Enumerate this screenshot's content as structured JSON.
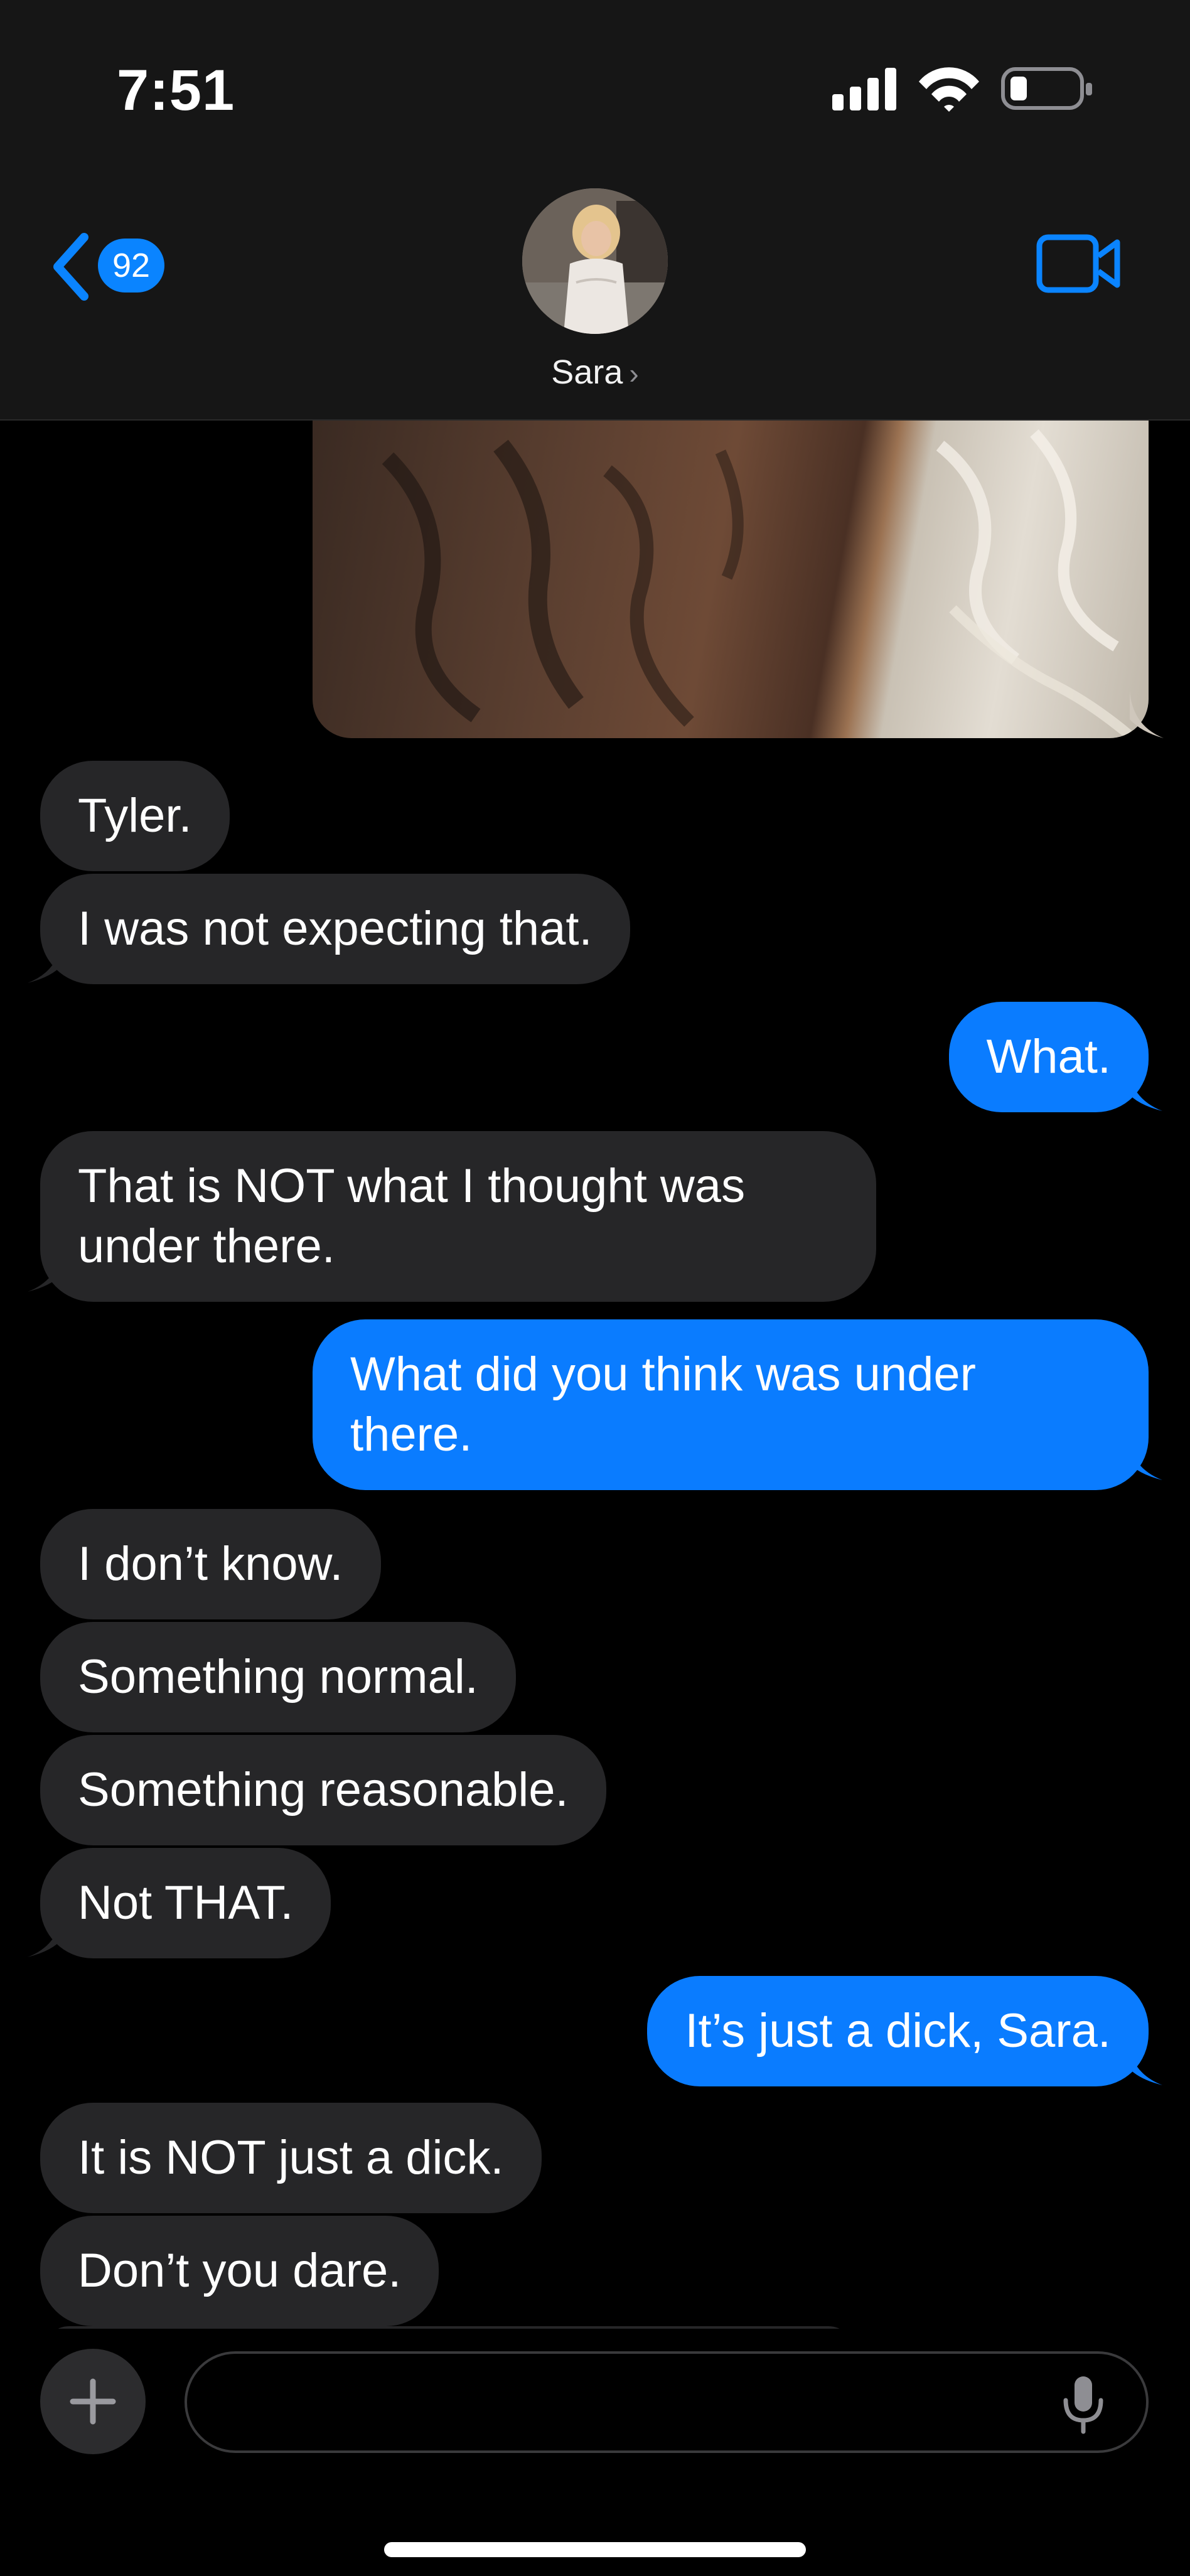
{
  "status_bar": {
    "time": "7:51",
    "icons": [
      "cellular-signal-icon",
      "wifi-icon",
      "battery-low-icon"
    ]
  },
  "header": {
    "back_badge": "92",
    "contact_name": "Sara",
    "name_chevron": "›",
    "video_icon": "video-camera-icon"
  },
  "messages": [
    {
      "side": "in",
      "text": "Tyler."
    },
    {
      "side": "in",
      "text": "I was not expecting that."
    },
    {
      "side": "out",
      "text": "What."
    },
    {
      "side": "in",
      "text": "That is NOT what I thought was under there."
    },
    {
      "side": "out",
      "text": "What did you think was under there."
    },
    {
      "side": "in",
      "text": "I don’t know."
    },
    {
      "side": "in",
      "text": "Something normal."
    },
    {
      "side": "in",
      "text": "Something reasonable."
    },
    {
      "side": "in",
      "text": "Not THAT."
    },
    {
      "side": "out",
      "text": "It’s just a dick, Sara."
    },
    {
      "side": "in",
      "text": "It is NOT just a dick."
    },
    {
      "side": "in",
      "text": "Don’t you dare."
    }
  ],
  "composer": {
    "placeholder": "",
    "plus_icon": "plus-icon",
    "mic_icon": "microphone-icon"
  },
  "colors": {
    "incoming_bubble": "#262628",
    "outgoing_bubble": "#0a7cff",
    "accent": "#0a84ff",
    "background": "#000000"
  }
}
